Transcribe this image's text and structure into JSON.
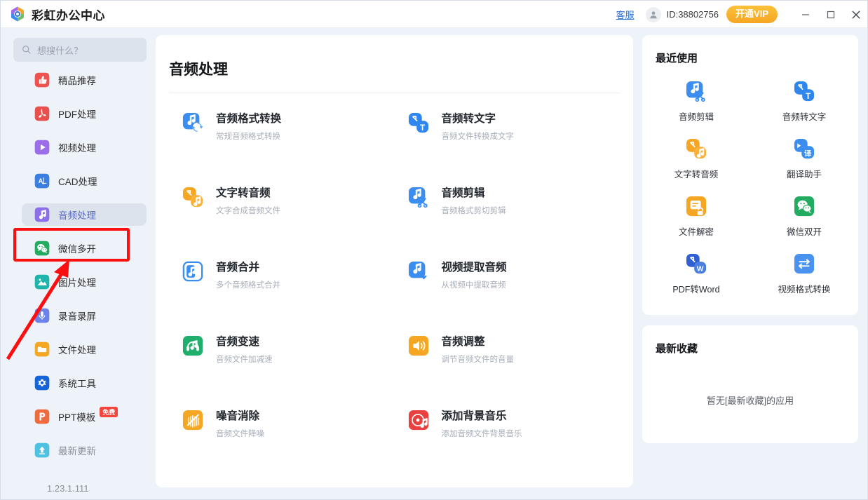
{
  "app": {
    "title": "彩虹办公中心",
    "logo_icon": "rainbow-hexagon-logo",
    "version": "1.23.1.111"
  },
  "titlebar": {
    "support_label": "客服",
    "avatar_icon": "user-avatar-icon",
    "user_id": "ID:38802756",
    "vip_button": "开通VIP",
    "minimize_icon": "minimize-icon",
    "maximize_icon": "maximize-icon",
    "close_icon": "close-icon"
  },
  "search": {
    "icon": "search-icon",
    "placeholder": "想搜什么？",
    "value": ""
  },
  "sidebar": {
    "items": [
      {
        "label": "精品推荐",
        "icon": "thumbs-up-icon",
        "color": "#ef5350",
        "active": false,
        "muted": false,
        "badge": ""
      },
      {
        "label": "PDF处理",
        "icon": "pdf-icon",
        "color": "#e8504e",
        "active": false,
        "muted": false,
        "badge": ""
      },
      {
        "label": "视频处理",
        "icon": "video-play-icon",
        "color": "#9b6de8",
        "active": false,
        "muted": false,
        "badge": ""
      },
      {
        "label": "CAD处理",
        "icon": "cad-icon",
        "color": "#3b7fe0",
        "active": false,
        "muted": false,
        "badge": ""
      },
      {
        "label": "音频处理",
        "icon": "music-note-icon",
        "color": "#8a6fe8",
        "active": true,
        "muted": false,
        "badge": ""
      },
      {
        "label": "微信多开",
        "icon": "wechat-icon",
        "color": "#22ab61",
        "active": false,
        "muted": false,
        "badge": ""
      },
      {
        "label": "图片处理",
        "icon": "image-icon",
        "color": "#1fb5ac",
        "active": false,
        "muted": false,
        "badge": ""
      },
      {
        "label": "录音录屏",
        "icon": "microphone-icon",
        "color": "#6b83e8",
        "active": false,
        "muted": false,
        "badge": ""
      },
      {
        "label": "文件处理",
        "icon": "folder-icon",
        "color": "#f5a623",
        "active": false,
        "muted": false,
        "badge": ""
      },
      {
        "label": "系统工具",
        "icon": "gear-icon",
        "color": "#1565d8",
        "active": false,
        "muted": false,
        "badge": ""
      },
      {
        "label": "PPT模板",
        "icon": "ppt-icon",
        "color": "#ed6b3f",
        "active": false,
        "muted": false,
        "badge": "免费"
      },
      {
        "label": "最新更新",
        "icon": "upload-icon",
        "color": "#4ec1e0",
        "active": false,
        "muted": true,
        "badge": ""
      }
    ]
  },
  "main": {
    "page_title": "音频处理",
    "tools": [
      {
        "name": "音频格式转换",
        "desc": "常规音频格式转换",
        "icon": "audio-convert-icon",
        "color": "#3b8ef0"
      },
      {
        "name": "音频转文字",
        "desc": "音频文件转换成文字",
        "icon": "audio-to-text-icon",
        "color": "#2f86ed"
      },
      {
        "name": "文字转音频",
        "desc": "文字合成音频文件",
        "icon": "text-to-audio-icon",
        "color": "#f5a623"
      },
      {
        "name": "音频剪辑",
        "desc": "音频格式剪切剪辑",
        "icon": "audio-cut-icon",
        "color": "#3b8ef0"
      },
      {
        "name": "音频合并",
        "desc": "多个音频格式合并",
        "icon": "audio-merge-icon",
        "color": "#3b8ef0"
      },
      {
        "name": "视频提取音频",
        "desc": "从视频中提取音频",
        "icon": "video-extract-audio-icon",
        "color": "#3b8ef0"
      },
      {
        "name": "音频变速",
        "desc": "音频文件加减速",
        "icon": "audio-speed-icon",
        "color": "#1fae6b"
      },
      {
        "name": "音频调整",
        "desc": "调节音频文件的音量",
        "icon": "volume-icon",
        "color": "#f5a623"
      },
      {
        "name": "噪音消除",
        "desc": "音频文件降噪",
        "icon": "noise-reduce-icon",
        "color": "#f5a623"
      },
      {
        "name": "添加背景音乐",
        "desc": "添加音频文件背景音乐",
        "icon": "background-music-icon",
        "color": "#e8413f"
      }
    ]
  },
  "recent_panel": {
    "title": "最近使用",
    "items": [
      {
        "label": "音频剪辑",
        "icon": "audio-cut-icon",
        "color": "#3b8ef0"
      },
      {
        "label": "音频转文字",
        "icon": "audio-to-text-icon",
        "color": "#2f86ed"
      },
      {
        "label": "文字转音频",
        "icon": "text-to-audio-icon",
        "color": "#f5a623"
      },
      {
        "label": "翻译助手",
        "icon": "translate-icon",
        "color": "#3b8ef0"
      },
      {
        "label": "文件解密",
        "icon": "file-decrypt-icon",
        "color": "#f5a623"
      },
      {
        "label": "微信双开",
        "icon": "wechat-icon",
        "color": "#22ab61"
      },
      {
        "label": "PDF转Word",
        "icon": "pdf-to-word-icon",
        "color": "#2f5fd0"
      },
      {
        "label": "视频格式转换",
        "icon": "video-convert-icon",
        "color": "#4a92f0"
      }
    ]
  },
  "favorites_panel": {
    "title": "最新收藏",
    "empty_text": "暂无[最新收藏]的应用"
  },
  "annotations": {
    "highlight_color": "#fb0f10",
    "target": "音频处理"
  }
}
